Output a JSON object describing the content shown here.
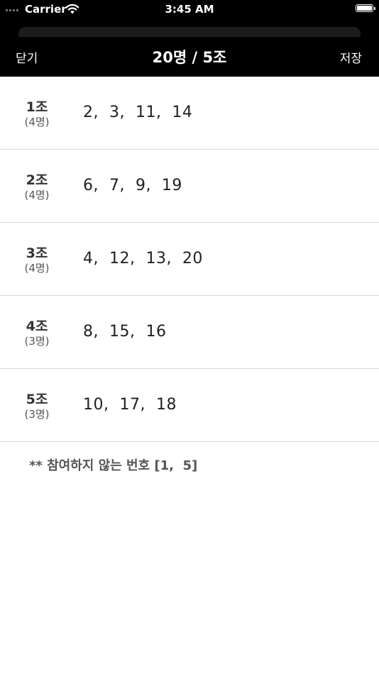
{
  "status_bar": {
    "carrier": "Carrier",
    "time": "3:45 AM"
  },
  "nav": {
    "close_label": "닫기",
    "title": "20명 / 5조",
    "save_label": "저장"
  },
  "groups": [
    {
      "name": "1조",
      "count": "(4명)",
      "members": "2,  3,  11,  14"
    },
    {
      "name": "2조",
      "count": "(4명)",
      "members": "6,  7,  9,  19"
    },
    {
      "name": "3조",
      "count": "(4명)",
      "members": "4,  12,  13,  20"
    },
    {
      "name": "4조",
      "count": "(3명)",
      "members": "8,  15,  16"
    },
    {
      "name": "5조",
      "count": "(3명)",
      "members": "10,  17,  18"
    }
  ],
  "footnote": "** 참여하지 않는 번호 [1,  5]",
  "icons": {
    "signal": "signal-dots-icon",
    "wifi": "wifi-icon",
    "battery": "battery-icon"
  },
  "colors": {
    "header_background": "#000000",
    "header_text": "#ffffff",
    "separator": "#d8d8d8"
  }
}
